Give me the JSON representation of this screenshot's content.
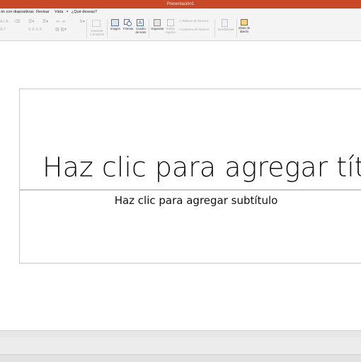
{
  "window": {
    "title": "Presentación1",
    "accent": "#c8492a"
  },
  "menu": {
    "items": [
      "ón con diapositivas",
      "Revisar",
      "Vista"
    ],
    "tell_me": "¿Qué deseas?"
  },
  "ribbon": {
    "convert": "Convertir\na SmartArt",
    "image": "Imagen",
    "shapes": "Formas",
    "textbox": "Cuadro\nde texto",
    "arrange": "Organizar",
    "quick_styles": "Estilos\nrápidos",
    "shape_fill": "Relleno de forma",
    "shape_outline": "Contorno de forma",
    "sensitivity": "Sensibilidad",
    "design_ideas": "Ideas de\ndiseño"
  },
  "slide": {
    "title_placeholder": "Haz clic para agregar títu",
    "subtitle_placeholder": "Haz clic para agregar subtítulo"
  }
}
